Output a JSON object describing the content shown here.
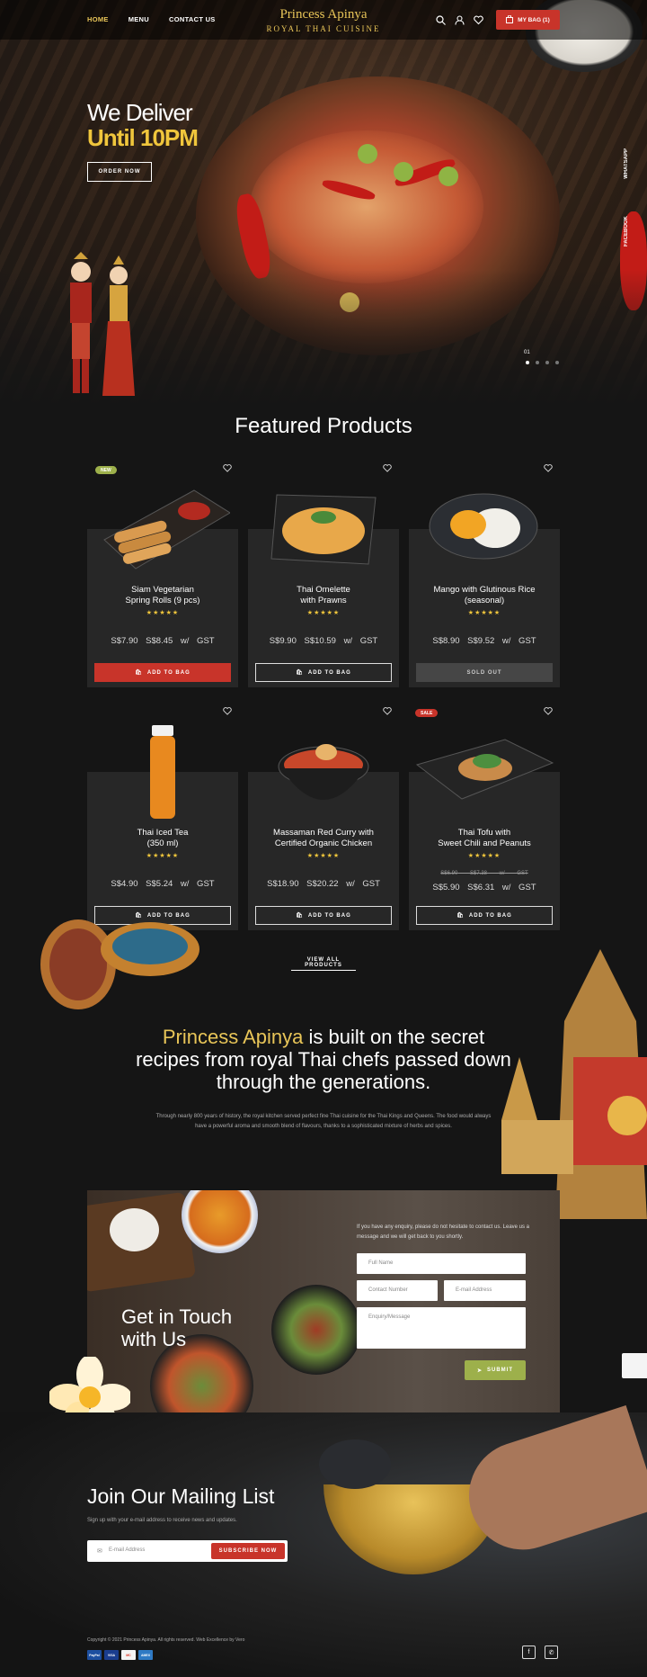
{
  "header": {
    "nav": [
      "HOME",
      "MENU",
      "CONTACT US"
    ],
    "logo_line1": "Princess Apinya",
    "logo_line2": "ROYAL THAI CUISINE",
    "bag_label": "MY BAG (1)",
    "icons": [
      "search-icon",
      "user-icon",
      "heart-icon",
      "bag-icon"
    ]
  },
  "hero": {
    "line1": "We Deliver",
    "line2": "Until 10PM",
    "cta": "ORDER NOW",
    "side_links": [
      "WHATSAPP",
      "FACEBOOK"
    ],
    "slide_number": "01",
    "slide_count": 4,
    "active_slide": 1
  },
  "featured": {
    "title": "Featured Products",
    "products": [
      {
        "name": "Siam Vegetarian\nSpring Rolls (9 pcs)",
        "rating": 5,
        "price": "S$7.90",
        "price_gst": "S$8.45 w/ GST",
        "button": "ADD TO BAG",
        "button_style": "red",
        "badge": "NEW"
      },
      {
        "name": "Thai Omelette\nwith Prawns",
        "rating": 5,
        "price": "S$9.90",
        "price_gst": "S$10.59 w/ GST",
        "button": "ADD TO BAG",
        "button_style": "outline",
        "badge": ""
      },
      {
        "name": "Mango with Glutinous Rice\n(seasonal)",
        "rating": 5,
        "price": "S$8.90",
        "price_gst": "S$9.52 w/ GST",
        "button": "SOLD OUT",
        "button_style": "grey",
        "badge": ""
      },
      {
        "name": "Thai Iced Tea\n(350 ml)",
        "rating": 5,
        "price": "S$4.90",
        "price_gst": "S$5.24 w/ GST",
        "button": "ADD TO BAG",
        "button_style": "outline",
        "badge": ""
      },
      {
        "name": "Massaman Red Curry with\nCertified Organic Chicken",
        "rating": 5,
        "price": "S$18.90",
        "price_gst": "S$20.22 w/ GST",
        "button": "ADD TO BAG",
        "button_style": "outline",
        "badge": ""
      },
      {
        "name": "Thai Tofu with\nSweet Chili and Peanuts",
        "rating": 5,
        "old_price": "S$6.90",
        "old_price_gst": "S$7.38 w/ GST",
        "price": "S$5.90",
        "price_gst": "S$6.31 w/ GST",
        "button": "ADD TO BAG",
        "button_style": "outline",
        "badge": "SALE"
      }
    ],
    "view_all": "VIEW ALL PRODUCTS"
  },
  "story": {
    "brand": "Princess Apinya",
    "headline": " is built on the secret recipes from royal Thai chefs passed down through the generations.",
    "paragraph": "Through nearly 800 years of history, the royal kitchen served perfect fine Thai cuisine for the Thai Kings and Queens. The food would always have a powerful aroma and smooth blend of flavours, thanks to a sophisticated mixture of herbs and spices."
  },
  "contact": {
    "title_line1": "Get in Touch",
    "title_line2": "with Us",
    "note": "If you have any enquiry, please do not hesitate to contact us. Leave us a message and we will get back to you shortly.",
    "fields": {
      "full_name": "Full Name",
      "contact_number": "Contact Number",
      "email": "E-mail Address",
      "message": "Enquiry/Message"
    },
    "submit": "SUBMIT"
  },
  "mailing": {
    "title": "Join Our Mailing List",
    "subtitle": "Sign up with your e-mail address to receive news and updates.",
    "placeholder": "E-mail Address",
    "button": "SUBSCRIBE NOW"
  },
  "footer": {
    "copyright": "Copyright © 2021 Princess Apinya. All rights reserved. Web Excellence by Vero",
    "payment": [
      "PayPal",
      "VISA",
      "MC",
      "AMEX"
    ]
  },
  "colors": {
    "accent_gold": "#e8c558",
    "accent_red": "#c8342a",
    "submit_green": "#9db04b",
    "star": "#f0c63c"
  }
}
